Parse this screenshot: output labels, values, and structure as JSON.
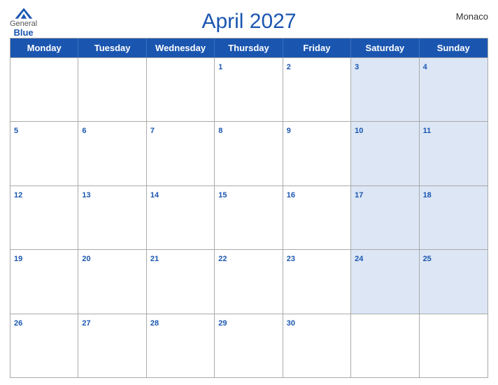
{
  "header": {
    "title": "April 2027",
    "country": "Monaco",
    "logo": {
      "general": "General",
      "blue": "Blue"
    }
  },
  "calendar": {
    "days_of_week": [
      "Monday",
      "Tuesday",
      "Wednesday",
      "Thursday",
      "Friday",
      "Saturday",
      "Sunday"
    ],
    "rows": [
      [
        {
          "day": "",
          "shaded": false
        },
        {
          "day": "",
          "shaded": false
        },
        {
          "day": "",
          "shaded": false
        },
        {
          "day": "1",
          "shaded": false
        },
        {
          "day": "2",
          "shaded": false
        },
        {
          "day": "3",
          "shaded": true
        },
        {
          "day": "4",
          "shaded": true
        }
      ],
      [
        {
          "day": "5",
          "shaded": false
        },
        {
          "day": "6",
          "shaded": false
        },
        {
          "day": "7",
          "shaded": false
        },
        {
          "day": "8",
          "shaded": false
        },
        {
          "day": "9",
          "shaded": false
        },
        {
          "day": "10",
          "shaded": true
        },
        {
          "day": "11",
          "shaded": true
        }
      ],
      [
        {
          "day": "12",
          "shaded": false
        },
        {
          "day": "13",
          "shaded": false
        },
        {
          "day": "14",
          "shaded": false
        },
        {
          "day": "15",
          "shaded": false
        },
        {
          "day": "16",
          "shaded": false
        },
        {
          "day": "17",
          "shaded": true
        },
        {
          "day": "18",
          "shaded": true
        }
      ],
      [
        {
          "day": "19",
          "shaded": false
        },
        {
          "day": "20",
          "shaded": false
        },
        {
          "day": "21",
          "shaded": false
        },
        {
          "day": "22",
          "shaded": false
        },
        {
          "day": "23",
          "shaded": false
        },
        {
          "day": "24",
          "shaded": true
        },
        {
          "day": "25",
          "shaded": true
        }
      ],
      [
        {
          "day": "26",
          "shaded": false
        },
        {
          "day": "27",
          "shaded": false
        },
        {
          "day": "28",
          "shaded": false
        },
        {
          "day": "29",
          "shaded": false
        },
        {
          "day": "30",
          "shaded": false
        },
        {
          "day": "",
          "shaded": true
        },
        {
          "day": "",
          "shaded": true
        }
      ]
    ]
  }
}
